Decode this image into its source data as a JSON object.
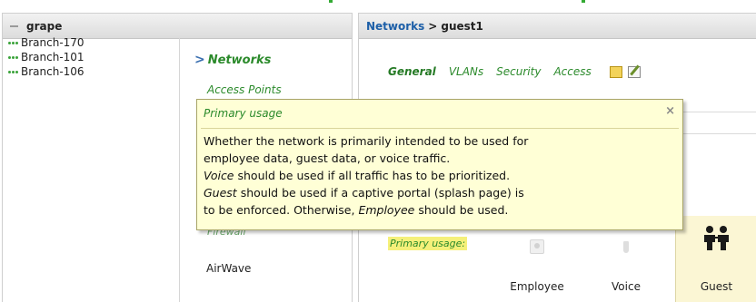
{
  "left_panel": {
    "group_name": "grape",
    "branches": [
      "Branch-170",
      "Branch-101",
      "Branch-106"
    ],
    "nav": {
      "current": "Networks",
      "access_points": "Access Points",
      "firewall": "Firewall",
      "airwave": "AirWave"
    }
  },
  "right_panel": {
    "breadcrumb": {
      "parent": "Networks",
      "separator": ">",
      "current": "guest1"
    },
    "tabs": [
      "General",
      "VLANs",
      "Security",
      "Access"
    ],
    "primary_usage_label": "Primary usage:",
    "usage_options": [
      "Employee",
      "Voice",
      "Guest"
    ],
    "selected_usage": "Guest"
  },
  "tooltip": {
    "title": "Primary usage",
    "close_glyph": "×",
    "line1": "Whether the network is primarily intended to be used for",
    "line2": "employee data, guest data, or voice traffic.",
    "line3_em": "Voice",
    "line3_rest": " should be used if all traffic has to be prioritized.",
    "line4_em": "Guest",
    "line4_rest": " should be used if a captive portal (splash page) is",
    "line5_a": "to be enforced. Otherwise, ",
    "line5_em": "Employee",
    "line5_b": " should be used."
  },
  "colors": {
    "accent_green": "#2b8a2b",
    "link_blue": "#1d5fa8",
    "tooltip_bg": "#ffffd6",
    "highlight_yellow": "#f5f07a"
  },
  "icons": {
    "collapse": "collapse-minus-icon",
    "branch_status": "status-dots-icon",
    "nav_arrow": "chevron-right-icon",
    "note": "note-icon",
    "edit": "edit-icon",
    "close": "close-icon",
    "employee": "person-icon",
    "voice": "phone-icon",
    "guest": "guest-people-icon"
  }
}
